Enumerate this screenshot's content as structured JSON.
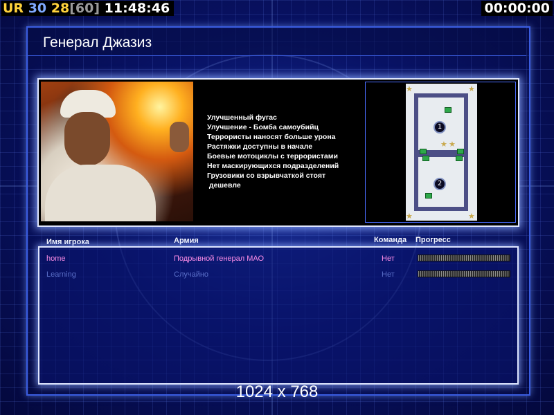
{
  "hud": {
    "ur": "UR",
    "fps": "30",
    "logic_fps": "28",
    "frame_cap": "[60]",
    "clock": "11:48:46",
    "game_timer": "00:00:00"
  },
  "general": {
    "name": "Генерал Джазиз",
    "traits": [
      "Улучшенный фугас",
      "Улучшение - Бомба самоубийц",
      "Террористы наносят больше урона",
      "Растяжки доступны в начале",
      "Боевые мотоциклы с террористами",
      "Нет маскирующихся подразделений",
      "Грузовики со взрывчаткой стоят",
      " дешевле"
    ]
  },
  "minimap": {
    "start_positions": [
      "1",
      "2"
    ]
  },
  "table": {
    "headers": {
      "player": "Имя игрока",
      "army": "Армия",
      "team": "Команда",
      "progress": "Прогресс"
    },
    "rows": [
      {
        "player": "home",
        "army": "Подрывной генерал МАО",
        "team": "Нет",
        "active": true
      },
      {
        "player": "Learning",
        "army": "Случайно",
        "team": "Нет",
        "active": false
      }
    ]
  },
  "resolution": "1024 x 768",
  "colors": {
    "background": "#06105a",
    "panel_border": "#dfe6ff",
    "hud_yellow": "#ffd23c",
    "hud_blue": "#7fa9ff",
    "active_row": "#ff8ee8",
    "inactive_row": "#5a6fc8"
  }
}
